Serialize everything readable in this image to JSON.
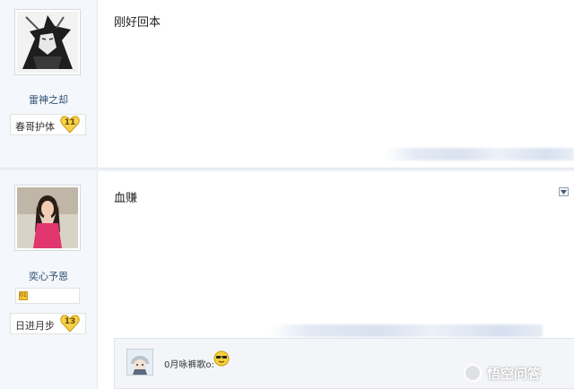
{
  "posts": [
    {
      "username": "雷神之却",
      "level_title": "春哥护体",
      "level": "11",
      "content": "刚好回本"
    },
    {
      "username": "奕心予恩",
      "medal_label": "01",
      "level_title": "日进月步",
      "level": "13",
      "content": "血赚",
      "reply": {
        "text": "0月咏裤歌o:"
      }
    }
  ],
  "watermark": {
    "text": "悟空问答",
    "icon": "wukong-logo-icon"
  },
  "icons": {
    "post_menu": "chevron-down-icon",
    "reply_emoji": "sunglasses-emoji-icon",
    "level_badge": "heart-badge-icon"
  },
  "colors": {
    "sidebar_bg": "#f4f7fb",
    "username": "#2f4f6f",
    "badge_gold": "#f5d04a",
    "reply_bg": "#f3f5f8"
  }
}
